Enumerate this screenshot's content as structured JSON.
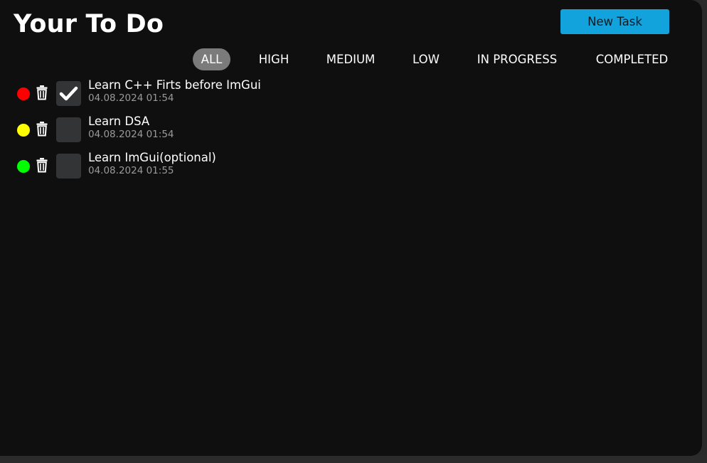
{
  "app": {
    "title": "Your To Do",
    "new_task_label": "New Task"
  },
  "filters": [
    {
      "label": "ALL",
      "active": true
    },
    {
      "label": "HIGH",
      "active": false
    },
    {
      "label": "MEDIUM",
      "active": false
    },
    {
      "label": "LOW",
      "active": false
    },
    {
      "label": "IN PROGRESS",
      "active": false
    },
    {
      "label": "COMPLETED",
      "active": false
    }
  ],
  "tasks": [
    {
      "title": "Learn C++ Firts before ImGui",
      "date": "04.08.2024 01:54",
      "priority": "high",
      "priority_color": "#ff0000",
      "completed": true
    },
    {
      "title": "Learn DSA",
      "date": "04.08.2024 01:54",
      "priority": "medium",
      "priority_color": "#ffff00",
      "completed": false
    },
    {
      "title": "Learn ImGui(optional)",
      "date": "04.08.2024 01:55",
      "priority": "low",
      "priority_color": "#00ff00",
      "completed": false
    }
  ],
  "icons": {
    "delete": "trash-icon",
    "check": "checkmark-icon"
  },
  "colors": {
    "background": "#0f0f10",
    "accent": "#12a3dc",
    "active_filter": "#7b7b7b",
    "checkbox": "#333436"
  }
}
